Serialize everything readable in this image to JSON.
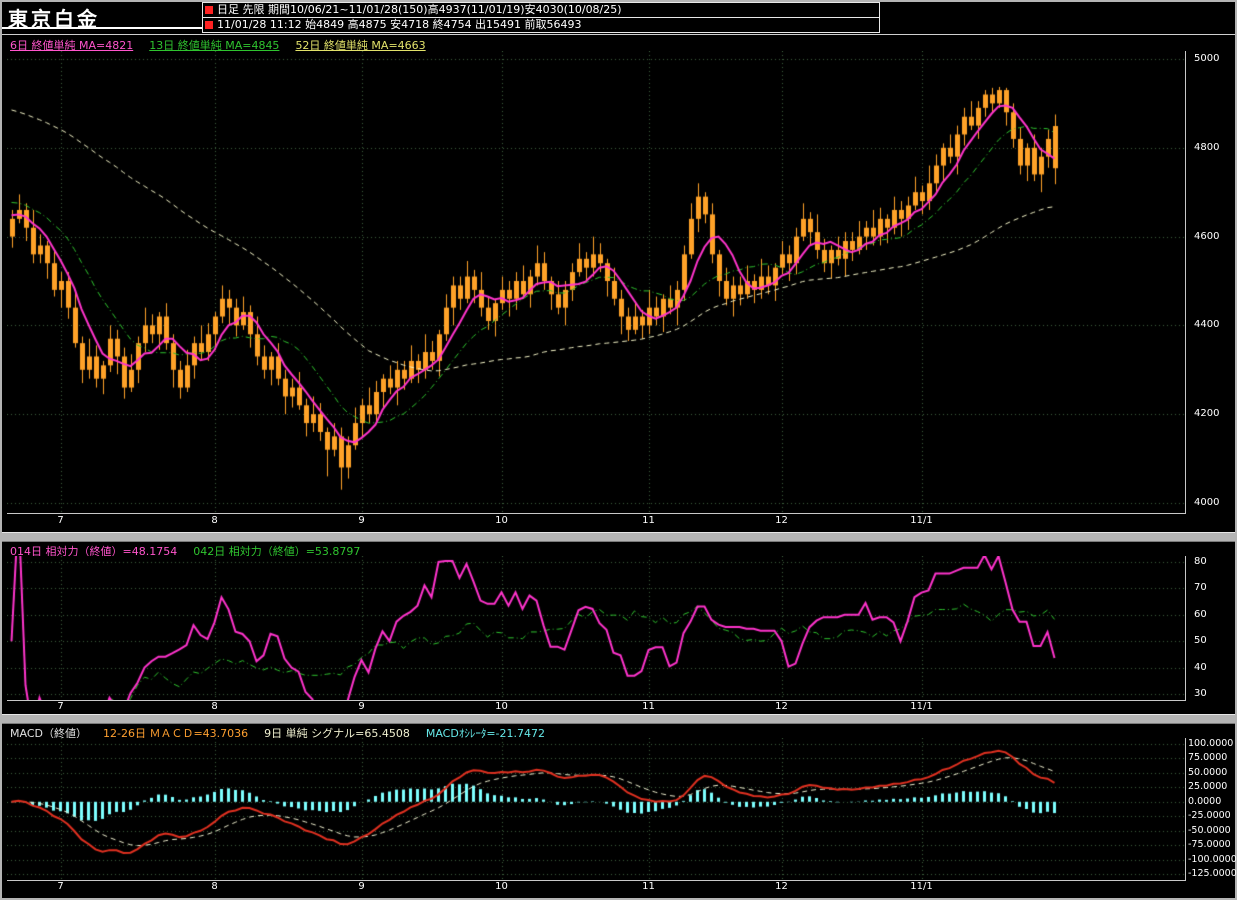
{
  "window": {
    "title": "東京白金"
  },
  "header": {
    "row1": "日足 先限 期間10/06/21~11/01/28(150)高4937(11/01/19)安4030(10/08/25)",
    "row2": "11/01/28 11:12 始4849 高4875 安4718 終4754 出15491 前取56493"
  },
  "legends": {
    "main": [
      {
        "label": "6日 終値単純 MA=4821",
        "color": "#ff55cc",
        "underline": true
      },
      {
        "label": "13日 終値単純 MA=4845",
        "color": "#2fc42f",
        "underline": true
      },
      {
        "label": "52日 終値単純 MA=4663",
        "color": "#e2e26a",
        "underline": true
      }
    ],
    "rsi": [
      {
        "label": "014日 相対力（終値）=48.1754",
        "color": "#ff55cc",
        "underline": true
      },
      {
        "label": "042日 相対力（終値）=53.8797",
        "color": "#2fc42f",
        "underline": true
      }
    ],
    "macd": [
      {
        "label": "MACD（終値）",
        "color": "#e0e0e0",
        "underline": false
      },
      {
        "label": "12-26日 ＭＡＣＤ=43.7036",
        "color": "#ffa030",
        "underline": true
      },
      {
        "label": "9日 単純 シグナル=65.4508",
        "color": "#f0f0d0",
        "underline": true
      },
      {
        "label": "MACDｵｼﾚｰﾀ=-21.7472",
        "color": "#66e8e8",
        "underline": true
      }
    ]
  },
  "colors": {
    "background": "#000000",
    "frame": "#b4b4b4",
    "grid": "#3d603d",
    "candle": "#ffa228",
    "ma6": "#ff33cc",
    "ma13": "#2fc42f",
    "ma52": "#f5f5c8",
    "rsi14": "#ff33cc",
    "rsi42": "#2fc42f",
    "macd_line": "#e03020",
    "signal_line": "#f0f0d0",
    "oscillator": "#7dffff",
    "axis_text": "#ffffff",
    "marker_red": "#ff2222"
  },
  "chart_data": {
    "type": "candlestick",
    "title": "東京白金 日足 先限",
    "period_label": "期間10/06/21~11/01/28(150)",
    "session_high": {
      "value": 4937,
      "date": "11/01/19"
    },
    "session_low": {
      "value": 4030,
      "date": "10/08/25"
    },
    "last_day": {
      "open": 4849,
      "high": 4875,
      "low": 4718,
      "close": 4754,
      "volume": 15491,
      "prev_volume": 56493
    },
    "x_axis": {
      "labels": [
        "7",
        "8",
        "9",
        "10",
        "11",
        "12",
        "11/1"
      ],
      "indices": [
        7,
        29,
        50,
        70,
        91,
        110,
        130
      ]
    },
    "panels": [
      {
        "name": "price",
        "ylim": [
          4000,
          5000
        ],
        "y_ticks": [
          5000,
          4800,
          4600,
          4400,
          4200,
          4000
        ],
        "y_tick_labels": [
          "5000",
          "4800",
          "4600",
          "4400",
          "4200",
          "4000"
        ],
        "moving_averages": [
          {
            "period": 6,
            "type": "終値単純",
            "last_value": 4821,
            "seed": 4650
          },
          {
            "period": 13,
            "type": "終値単純",
            "last_value": 4845,
            "seed": 4680
          },
          {
            "period": 52,
            "type": "終値単純",
            "last_value": 4663,
            "seed": 4890
          }
        ],
        "candles": [
          [
            4600,
            4660,
            4575,
            4640
          ],
          [
            4640,
            4695,
            4630,
            4660
          ],
          [
            4660,
            4675,
            4590,
            4620
          ],
          [
            4620,
            4660,
            4540,
            4560
          ],
          [
            4560,
            4605,
            4540,
            4580
          ],
          [
            4580,
            4590,
            4505,
            4540
          ],
          [
            4540,
            4570,
            4465,
            4480
          ],
          [
            4480,
            4520,
            4440,
            4500
          ],
          [
            4500,
            4520,
            4415,
            4440
          ],
          [
            4440,
            4475,
            4350,
            4360
          ],
          [
            4360,
            4375,
            4270,
            4300
          ],
          [
            4300,
            4370,
            4280,
            4330
          ],
          [
            4330,
            4355,
            4260,
            4280
          ],
          [
            4280,
            4320,
            4245,
            4310
          ],
          [
            4310,
            4400,
            4295,
            4370
          ],
          [
            4370,
            4390,
            4290,
            4330
          ],
          [
            4330,
            4350,
            4235,
            4260
          ],
          [
            4260,
            4335,
            4250,
            4300
          ],
          [
            4300,
            4375,
            4270,
            4360
          ],
          [
            4360,
            4440,
            4340,
            4400
          ],
          [
            4400,
            4425,
            4360,
            4380
          ],
          [
            4380,
            4430,
            4345,
            4420
          ],
          [
            4420,
            4450,
            4345,
            4360
          ],
          [
            4360,
            4380,
            4260,
            4300
          ],
          [
            4300,
            4320,
            4235,
            4260
          ],
          [
            4260,
            4345,
            4250,
            4310
          ],
          [
            4310,
            4375,
            4280,
            4360
          ],
          [
            4360,
            4400,
            4320,
            4340
          ],
          [
            4340,
            4405,
            4320,
            4380
          ],
          [
            4380,
            4430,
            4345,
            4420
          ],
          [
            4420,
            4490,
            4405,
            4460
          ],
          [
            4460,
            4480,
            4400,
            4440
          ],
          [
            4440,
            4460,
            4375,
            4400
          ],
          [
            4400,
            4465,
            4390,
            4430
          ],
          [
            4430,
            4445,
            4350,
            4380
          ],
          [
            4380,
            4420,
            4310,
            4330
          ],
          [
            4330,
            4355,
            4280,
            4300
          ],
          [
            4300,
            4340,
            4265,
            4330
          ],
          [
            4330,
            4360,
            4265,
            4280
          ],
          [
            4280,
            4300,
            4200,
            4240
          ],
          [
            4240,
            4280,
            4215,
            4260
          ],
          [
            4260,
            4295,
            4210,
            4220
          ],
          [
            4220,
            4235,
            4150,
            4180
          ],
          [
            4180,
            4240,
            4160,
            4200
          ],
          [
            4200,
            4225,
            4140,
            4160
          ],
          [
            4160,
            4170,
            4060,
            4120
          ],
          [
            4120,
            4180,
            4105,
            4150
          ],
          [
            4150,
            4170,
            4030,
            4080
          ],
          [
            4080,
            4150,
            4055,
            4130
          ],
          [
            4130,
            4215,
            4120,
            4180
          ],
          [
            4180,
            4235,
            4150,
            4220
          ],
          [
            4220,
            4260,
            4180,
            4200
          ],
          [
            4200,
            4275,
            4180,
            4250
          ],
          [
            4250,
            4290,
            4215,
            4280
          ],
          [
            4280,
            4310,
            4245,
            4260
          ],
          [
            4260,
            4320,
            4220,
            4300
          ],
          [
            4300,
            4320,
            4255,
            4280
          ],
          [
            4280,
            4355,
            4270,
            4320
          ],
          [
            4320,
            4335,
            4270,
            4300
          ],
          [
            4300,
            4380,
            4280,
            4340
          ],
          [
            4340,
            4365,
            4300,
            4320
          ],
          [
            4320,
            4390,
            4285,
            4380
          ],
          [
            4380,
            4470,
            4365,
            4440
          ],
          [
            4440,
            4510,
            4400,
            4490
          ],
          [
            4490,
            4510,
            4435,
            4460
          ],
          [
            4460,
            4545,
            4450,
            4510
          ],
          [
            4510,
            4525,
            4450,
            4480
          ],
          [
            4480,
            4520,
            4420,
            4440
          ],
          [
            4440,
            4465,
            4390,
            4410
          ],
          [
            4410,
            4460,
            4375,
            4450
          ],
          [
            4450,
            4510,
            4435,
            4480
          ],
          [
            4480,
            4500,
            4420,
            4460
          ],
          [
            4460,
            4520,
            4435,
            4500
          ],
          [
            4500,
            4535,
            4460,
            4470
          ],
          [
            4470,
            4525,
            4440,
            4510
          ],
          [
            4510,
            4580,
            4490,
            4540
          ],
          [
            4540,
            4565,
            4480,
            4500
          ],
          [
            4500,
            4510,
            4435,
            4470
          ],
          [
            4470,
            4500,
            4425,
            4440
          ],
          [
            4440,
            4500,
            4400,
            4480
          ],
          [
            4480,
            4540,
            4455,
            4520
          ],
          [
            4520,
            4585,
            4510,
            4550
          ],
          [
            4550,
            4565,
            4500,
            4530
          ],
          [
            4530,
            4600,
            4510,
            4560
          ],
          [
            4560,
            4585,
            4520,
            4540
          ],
          [
            4540,
            4550,
            4465,
            4500
          ],
          [
            4500,
            4530,
            4445,
            4460
          ],
          [
            4460,
            4480,
            4380,
            4420
          ],
          [
            4420,
            4440,
            4365,
            4390
          ],
          [
            4390,
            4455,
            4380,
            4420
          ],
          [
            4420,
            4435,
            4370,
            4400
          ],
          [
            4400,
            4480,
            4380,
            4440
          ],
          [
            4440,
            4465,
            4400,
            4420
          ],
          [
            4420,
            4470,
            4385,
            4460
          ],
          [
            4460,
            4490,
            4425,
            4440
          ],
          [
            4440,
            4500,
            4400,
            4480
          ],
          [
            4480,
            4580,
            4455,
            4560
          ],
          [
            4560,
            4675,
            4550,
            4640
          ],
          [
            4640,
            4720,
            4610,
            4690
          ],
          [
            4690,
            4700,
            4630,
            4650
          ],
          [
            4650,
            4675,
            4540,
            4560
          ],
          [
            4560,
            4570,
            4465,
            4500
          ],
          [
            4500,
            4530,
            4445,
            4460
          ],
          [
            4460,
            4510,
            4420,
            4490
          ],
          [
            4490,
            4510,
            4445,
            4470
          ],
          [
            4470,
            4535,
            4460,
            4500
          ],
          [
            4500,
            4515,
            4450,
            4480
          ],
          [
            4480,
            4550,
            4460,
            4510
          ],
          [
            4510,
            4535,
            4470,
            4490
          ],
          [
            4490,
            4540,
            4455,
            4530
          ],
          [
            4530,
            4590,
            4515,
            4560
          ],
          [
            4560,
            4580,
            4500,
            4540
          ],
          [
            4540,
            4620,
            4515,
            4600
          ],
          [
            4600,
            4675,
            4590,
            4640
          ],
          [
            4640,
            4655,
            4580,
            4610
          ],
          [
            4610,
            4650,
            4550,
            4570
          ],
          [
            4570,
            4595,
            4520,
            4540
          ],
          [
            4540,
            4580,
            4505,
            4570
          ],
          [
            4570,
            4600,
            4535,
            4550
          ],
          [
            4550,
            4610,
            4510,
            4590
          ],
          [
            4590,
            4610,
            4545,
            4570
          ],
          [
            4570,
            4635,
            4560,
            4600
          ],
          [
            4600,
            4635,
            4570,
            4620
          ],
          [
            4620,
            4660,
            4580,
            4600
          ],
          [
            4600,
            4665,
            4580,
            4640
          ],
          [
            4640,
            4650,
            4585,
            4620
          ],
          [
            4620,
            4690,
            4605,
            4660
          ],
          [
            4660,
            4680,
            4600,
            4640
          ],
          [
            4640,
            4690,
            4615,
            4670
          ],
          [
            4670,
            4735,
            4660,
            4700
          ],
          [
            4700,
            4715,
            4650,
            4680
          ],
          [
            4680,
            4760,
            4660,
            4720
          ],
          [
            4720,
            4785,
            4700,
            4760
          ],
          [
            4760,
            4810,
            4725,
            4800
          ],
          [
            4800,
            4830,
            4765,
            4780
          ],
          [
            4780,
            4850,
            4740,
            4830
          ],
          [
            4830,
            4890,
            4805,
            4870
          ],
          [
            4870,
            4905,
            4840,
            4850
          ],
          [
            4850,
            4905,
            4820,
            4890
          ],
          [
            4890,
            4930,
            4870,
            4920
          ],
          [
            4920,
            4935,
            4880,
            4900
          ],
          [
            4900,
            4937,
            4890,
            4930
          ],
          [
            4930,
            4935,
            4850,
            4880
          ],
          [
            4880,
            4900,
            4800,
            4820
          ],
          [
            4820,
            4845,
            4740,
            4760
          ],
          [
            4760,
            4810,
            4725,
            4800
          ],
          [
            4800,
            4830,
            4725,
            4740
          ],
          [
            4740,
            4800,
            4700,
            4780
          ],
          [
            4780,
            4840,
            4755,
            4820
          ],
          [
            4849,
            4875,
            4718,
            4754
          ]
        ]
      },
      {
        "name": "rsi",
        "ylim": [
          30,
          80
        ],
        "y_ticks": [
          80,
          70,
          60,
          50,
          40,
          30
        ],
        "y_tick_labels": [
          "80",
          "70",
          "60",
          "50",
          "40",
          "30"
        ],
        "series": [
          {
            "name": "014日 相対力（終値）",
            "period": 14,
            "last_value": 48.1754
          },
          {
            "name": "042日 相対力（終値）",
            "period": 42,
            "last_value": 53.8797
          }
        ]
      },
      {
        "name": "macd",
        "ylim": [
          -125,
          100
        ],
        "y_ticks": [
          100,
          75,
          50,
          25,
          0,
          -25,
          -50,
          -75,
          -100,
          -125
        ],
        "y_tick_labels": [
          "100.0000",
          "75.0000",
          "50.0000",
          "25.0000",
          "0.0000",
          "-25.0000",
          "-50.0000",
          "-75.0000",
          "-100.0000",
          "-125.0000"
        ],
        "params": {
          "fast": 12,
          "slow": 26,
          "signal_period": 9
        },
        "last_values": {
          "macd": 43.7036,
          "signal": 65.4508,
          "oscillator": -21.7472
        }
      }
    ]
  }
}
